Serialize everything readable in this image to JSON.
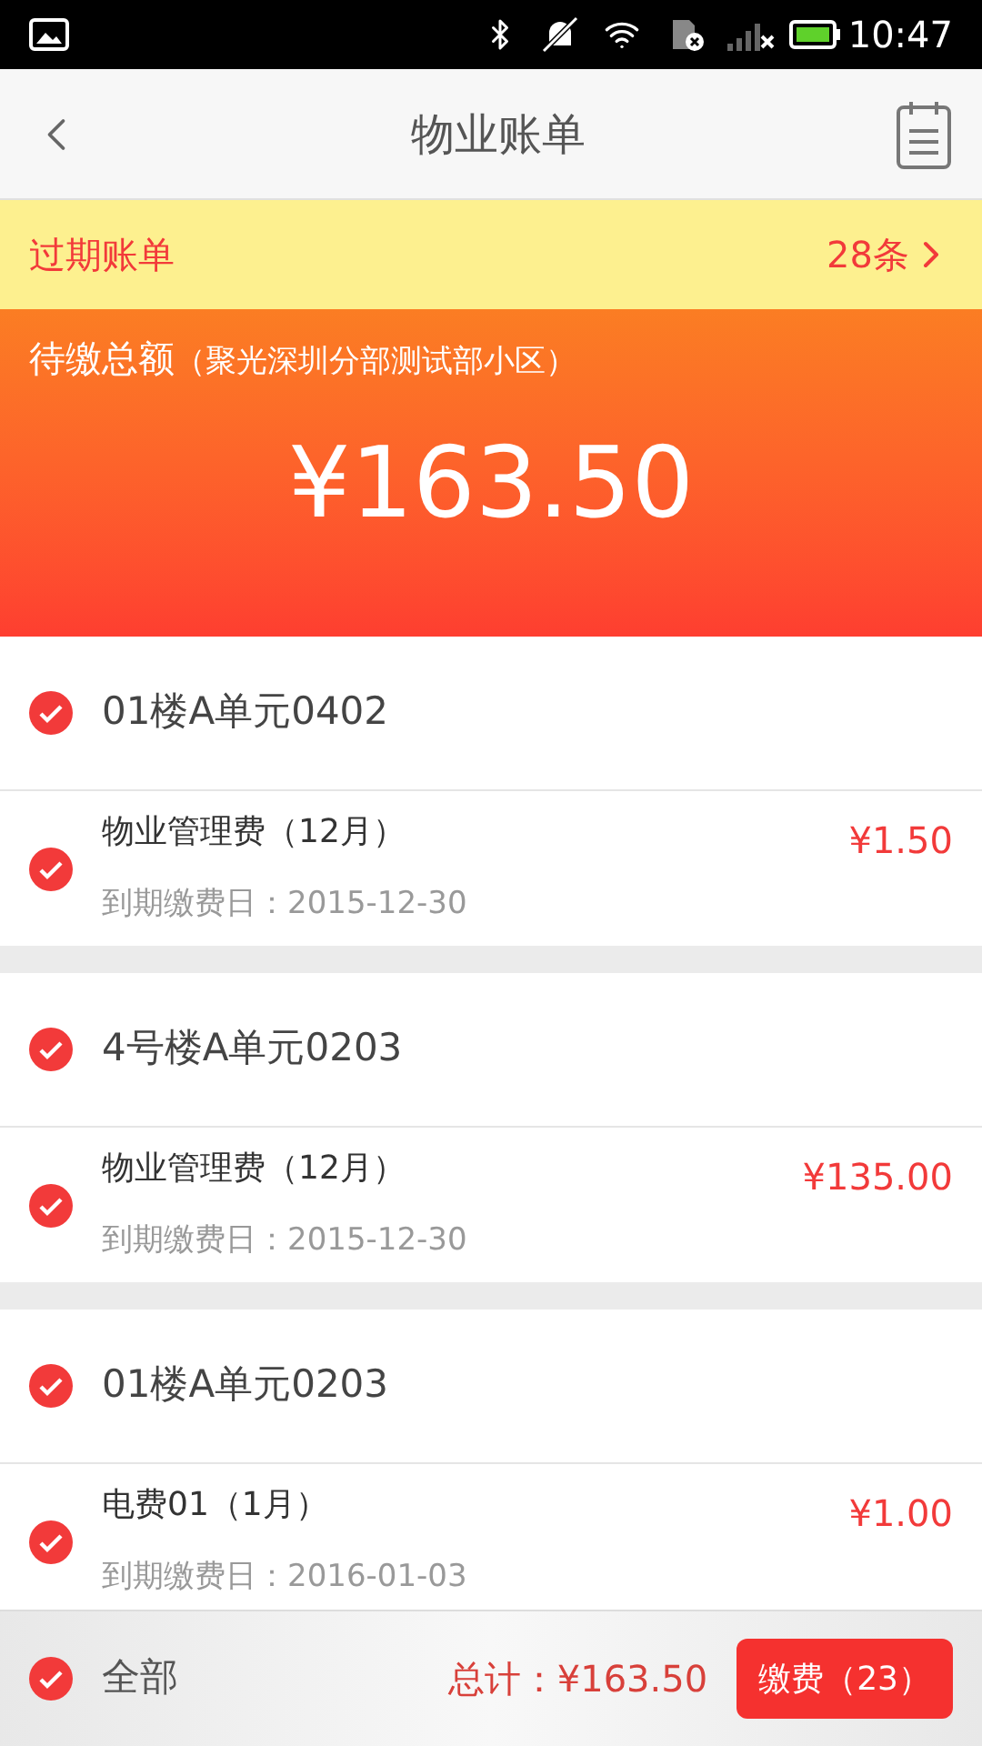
{
  "status_bar": {
    "time": "10:47"
  },
  "header": {
    "title": "物业账单"
  },
  "overdue": {
    "label": "过期账单",
    "count": "28条"
  },
  "summary": {
    "label": "待缴总额",
    "community": "（聚光深圳分部测试部小区）",
    "amount": "¥163.50"
  },
  "groups": [
    {
      "building": "01楼A单元0402",
      "checked": true,
      "items": [
        {
          "name": "物业管理费（12月）",
          "due_date": "到期缴费日：2015-12-30",
          "amount": "¥1.50",
          "checked": true
        }
      ]
    },
    {
      "building": "4号楼A单元0203",
      "checked": true,
      "items": [
        {
          "name": "物业管理费（12月）",
          "due_date": "到期缴费日：2015-12-30",
          "amount": "¥135.00",
          "checked": true
        }
      ]
    },
    {
      "building": "01楼A单元0203",
      "checked": true,
      "items": [
        {
          "name": "电费01（1月）",
          "due_date": "到期缴费日：2016-01-03",
          "amount": "¥1.00",
          "checked": true
        }
      ]
    }
  ],
  "footer": {
    "select_all": {
      "label": "全部",
      "checked": true
    },
    "total": "总计：¥163.50",
    "pay_button": "缴费（23）"
  }
}
